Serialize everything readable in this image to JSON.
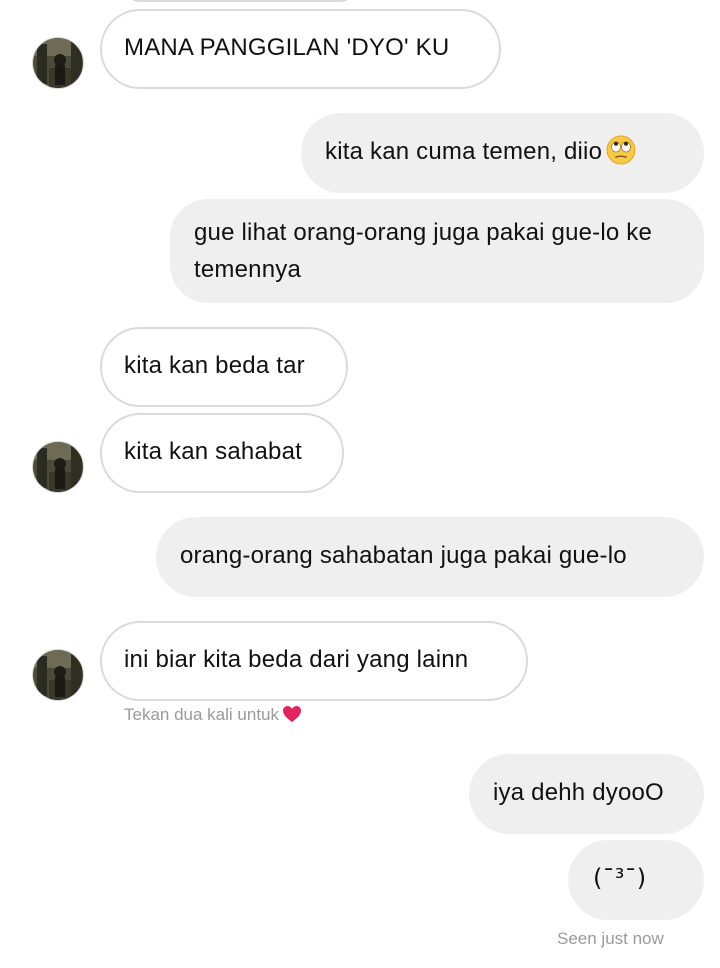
{
  "messages": [
    {
      "id": "m1",
      "side": "incoming",
      "text": "MANA PANGGILAN 'DYO' KU",
      "has_avatar": true
    },
    {
      "id": "m2",
      "side": "outgoing",
      "text": "kita kan cuma temen, diio",
      "emoji": "face-with-rolling-eyes"
    },
    {
      "id": "m3",
      "side": "outgoing",
      "text": "gue lihat orang-orang juga pakai gue-lo ke temennya"
    },
    {
      "id": "m4",
      "side": "incoming",
      "text": "kita kan beda tar",
      "has_avatar": false
    },
    {
      "id": "m5",
      "side": "incoming",
      "text": "kita kan sahabat",
      "has_avatar": true
    },
    {
      "id": "m6",
      "side": "outgoing",
      "text": "orang-orang sahabatan juga pakai gue-lo"
    },
    {
      "id": "m7",
      "side": "incoming",
      "text": "ini biar kita beda dari yang lainn",
      "has_avatar": true
    },
    {
      "id": "m8",
      "side": "outgoing",
      "text": "iya dehh dyooO"
    },
    {
      "id": "m9",
      "side": "outgoing",
      "text": "(¯³¯)"
    }
  ],
  "hints": {
    "double_tap": "Tekan dua kali untuk",
    "double_tap_icon": "red-heart-icon"
  },
  "status": {
    "seen": "Seen just now"
  },
  "colors": {
    "incoming_border": "#dadada",
    "outgoing_bg": "#efefef",
    "meta_text": "#9a9a9a",
    "heart": "#e0245e"
  }
}
